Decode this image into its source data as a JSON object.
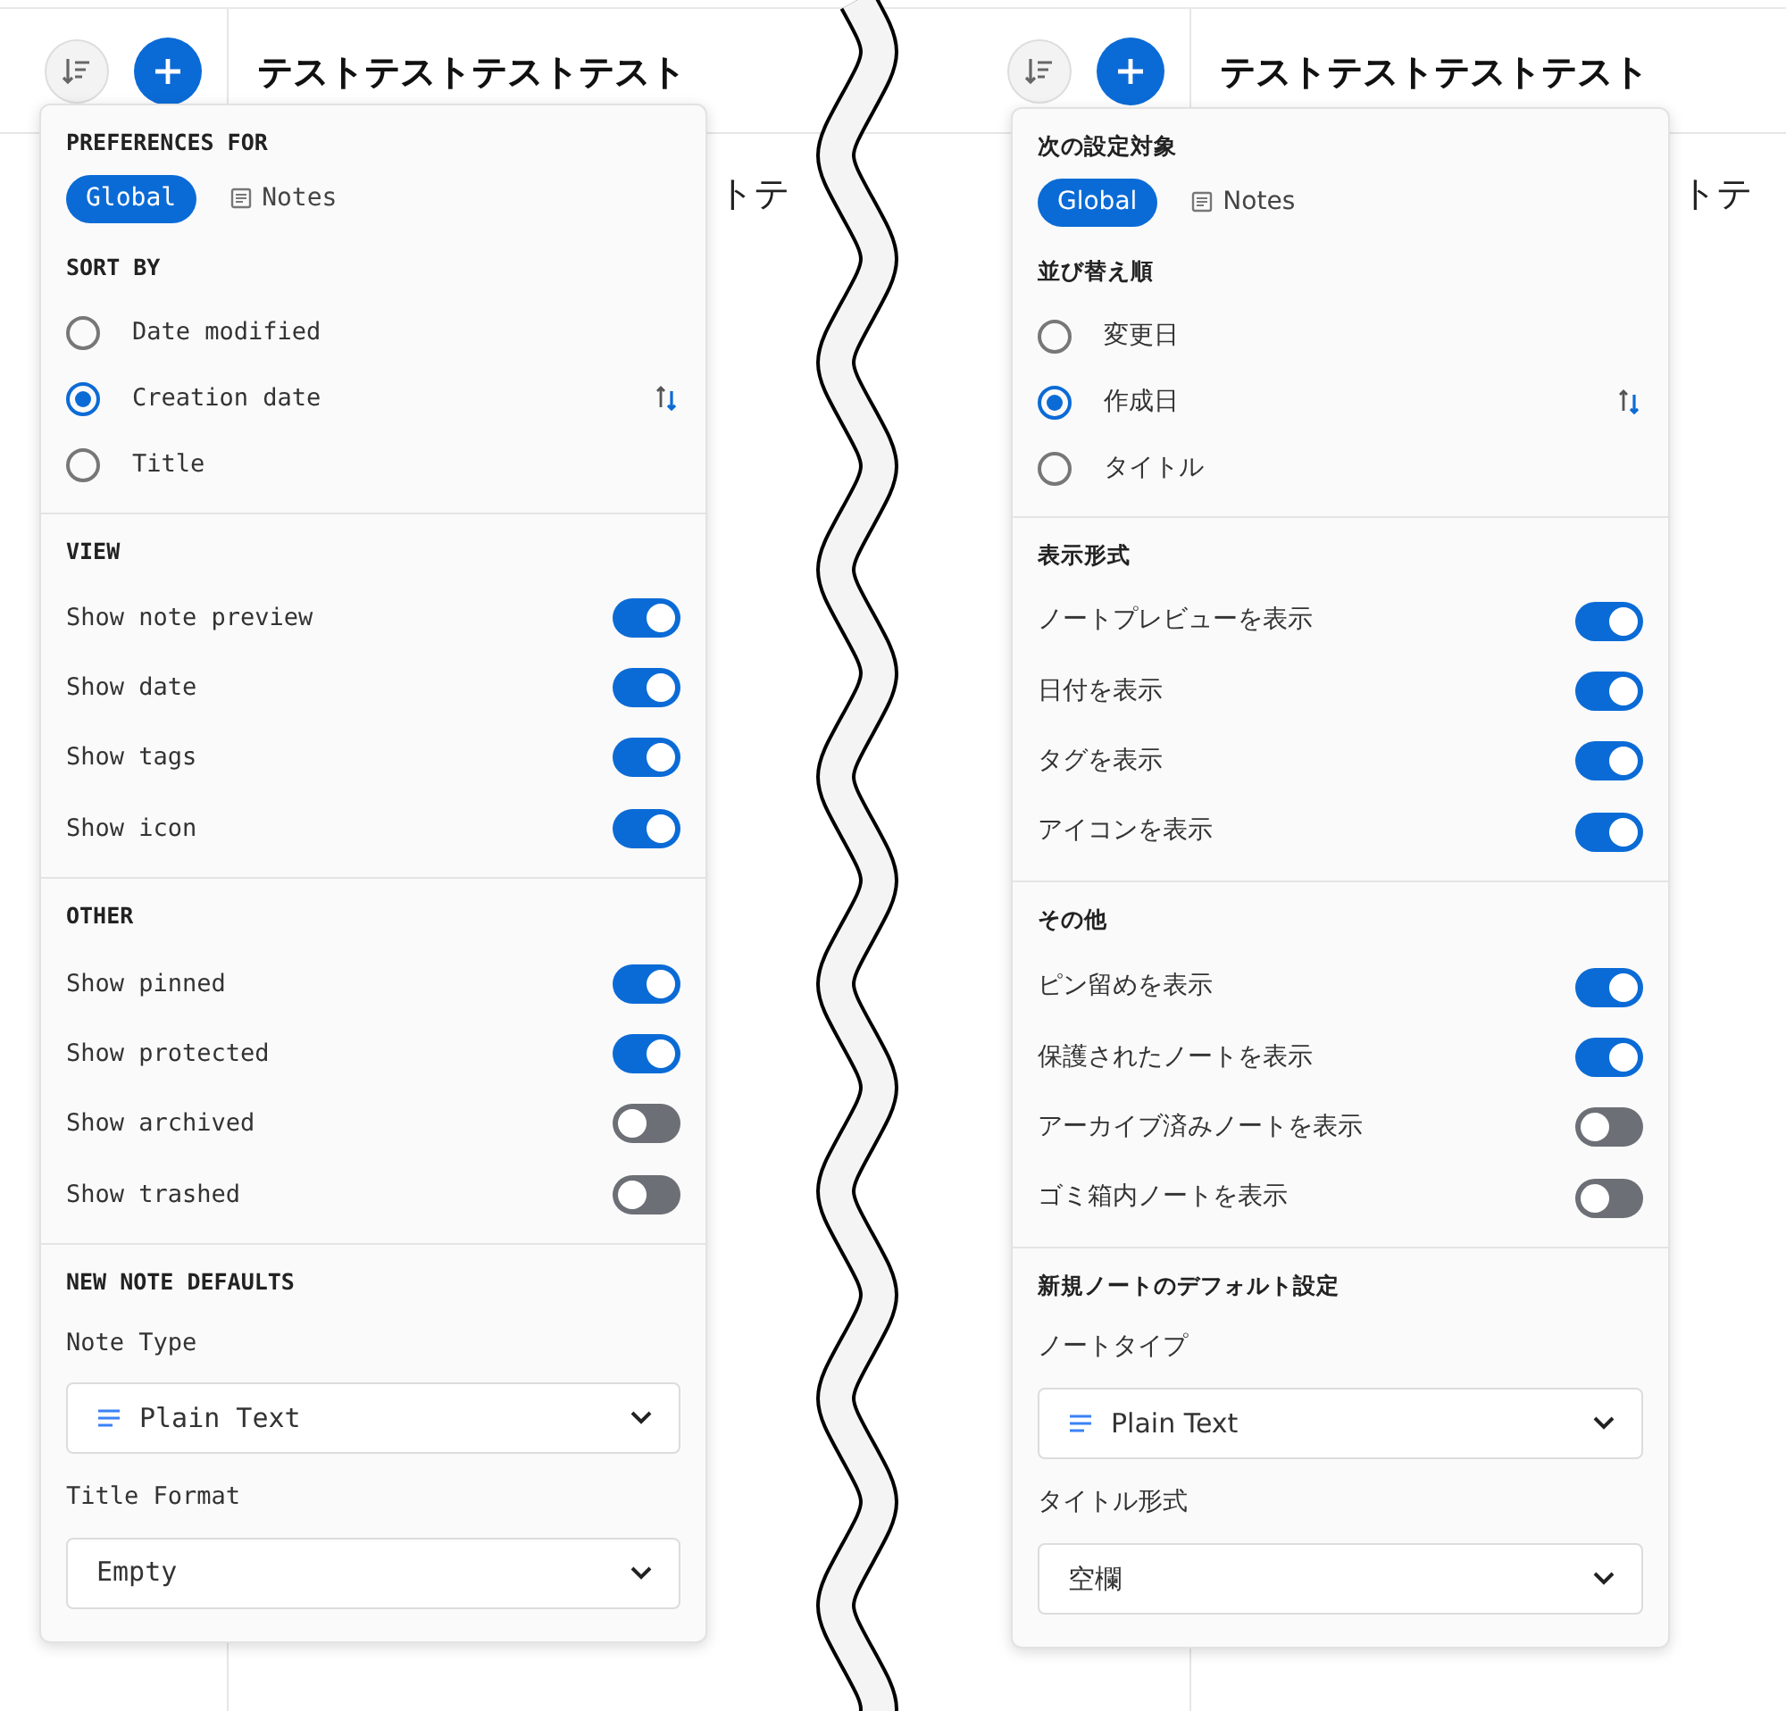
{
  "panels": [
    {
      "header": {
        "title": "テストテストテストテスト"
      },
      "note_title_fragment": "トテ",
      "popup": {
        "preferences_for": {
          "heading": "PREFERENCES FOR",
          "scopes": [
            {
              "label": "Global",
              "selected": true,
              "kind": "global"
            },
            {
              "label": "Notes",
              "selected": false,
              "kind": "notes"
            }
          ]
        },
        "sort_by": {
          "heading": "SORT BY",
          "options": [
            {
              "label": "Date modified",
              "selected": false
            },
            {
              "label": "Creation date",
              "selected": true
            },
            {
              "label": "Title",
              "selected": false
            }
          ]
        },
        "view": {
          "heading": "VIEW",
          "toggles": [
            {
              "label": "Show note preview",
              "on": true
            },
            {
              "label": "Show date",
              "on": true
            },
            {
              "label": "Show tags",
              "on": true
            },
            {
              "label": "Show icon",
              "on": true
            }
          ]
        },
        "other": {
          "heading": "OTHER",
          "toggles": [
            {
              "label": "Show pinned",
              "on": true
            },
            {
              "label": "Show protected",
              "on": true
            },
            {
              "label": "Show archived",
              "on": false
            },
            {
              "label": "Show trashed",
              "on": false
            }
          ]
        },
        "new_note_defaults": {
          "heading": "NEW NOTE DEFAULTS",
          "note_type": {
            "label": "Note Type",
            "value": "Plain Text"
          },
          "title_format": {
            "label": "Title Format",
            "value": "Empty"
          }
        }
      }
    },
    {
      "header": {
        "title": "テストテストテストテスト"
      },
      "note_title_fragment": "トテ",
      "popup": {
        "preferences_for": {
          "heading": "次の設定対象",
          "scopes": [
            {
              "label": "Global",
              "selected": true,
              "kind": "global"
            },
            {
              "label": "Notes",
              "selected": false,
              "kind": "notes"
            }
          ]
        },
        "sort_by": {
          "heading": "並び替え順",
          "options": [
            {
              "label": "変更日",
              "selected": false
            },
            {
              "label": "作成日",
              "selected": true
            },
            {
              "label": "タイトル",
              "selected": false
            }
          ]
        },
        "view": {
          "heading": "表示形式",
          "toggles": [
            {
              "label": "ノートプレビューを表示",
              "on": true
            },
            {
              "label": "日付を表示",
              "on": true
            },
            {
              "label": "タグを表示",
              "on": true
            },
            {
              "label": "アイコンを表示",
              "on": true
            }
          ]
        },
        "other": {
          "heading": "その他",
          "toggles": [
            {
              "label": "ピン留めを表示",
              "on": true
            },
            {
              "label": "保護されたノートを表示",
              "on": true
            },
            {
              "label": "アーカイブ済みノートを表示",
              "on": false
            },
            {
              "label": "ゴミ箱内ノートを表示",
              "on": false
            }
          ]
        },
        "new_note_defaults": {
          "heading": "新規ノートのデフォルト設定",
          "note_type": {
            "label": "ノートタイプ",
            "value": "Plain Text"
          },
          "title_format": {
            "label": "タイトル形式",
            "value": "空欄"
          }
        }
      }
    }
  ]
}
